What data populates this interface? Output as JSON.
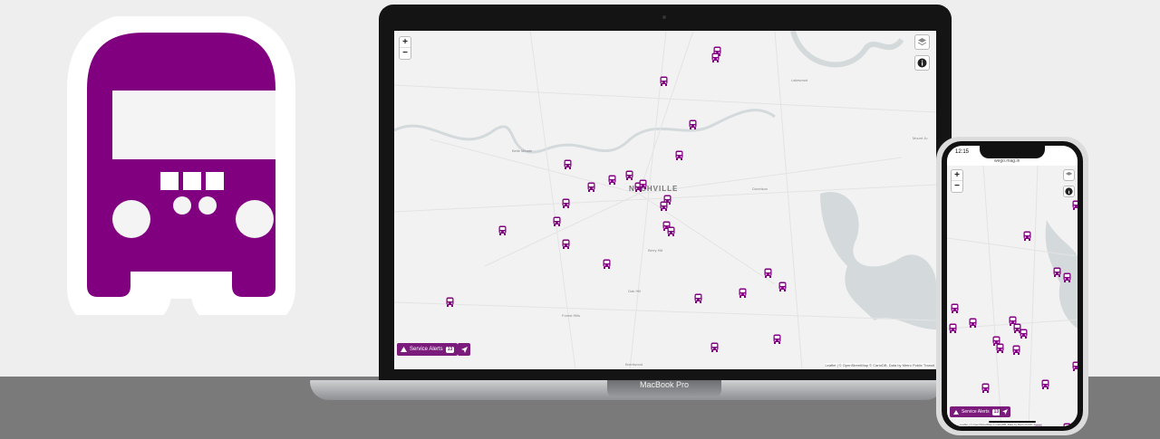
{
  "laptop": {
    "brand": "MacBook Pro",
    "map": {
      "zoom_in": "+",
      "zoom_out": "−",
      "city_label": "NASHVILLE",
      "places": [
        "Brentwood",
        "Forest Hills",
        "Oak Hill",
        "Belle Meade",
        "Berry Hill",
        "Donelson",
        "Lakewood",
        "Mount Ju"
      ],
      "alerts_label": "Service Alerts",
      "alerts_count": "13",
      "attribution": "Leaflet | © OpenStreetMap © CartoDB, Data by Metro Public Transit"
    }
  },
  "phone": {
    "time": "12:15",
    "url": "wego.mag.in",
    "map": {
      "zoom_in": "+",
      "zoom_out": "−",
      "alerts_label": "Service Alerts",
      "alerts_count": "13",
      "attribution": "Leaflet | © OpenStreetMap © CartoDB, Data by Metro Public Transit"
    }
  },
  "colors": {
    "brand": "#800080",
    "map_water": "#d4dadc",
    "map_bg": "#f2f2f2"
  },
  "icons": [
    "bus-logo-icon",
    "bus-marker-icon",
    "layers-icon",
    "info-icon",
    "warning-icon",
    "locate-arrow-icon"
  ]
}
